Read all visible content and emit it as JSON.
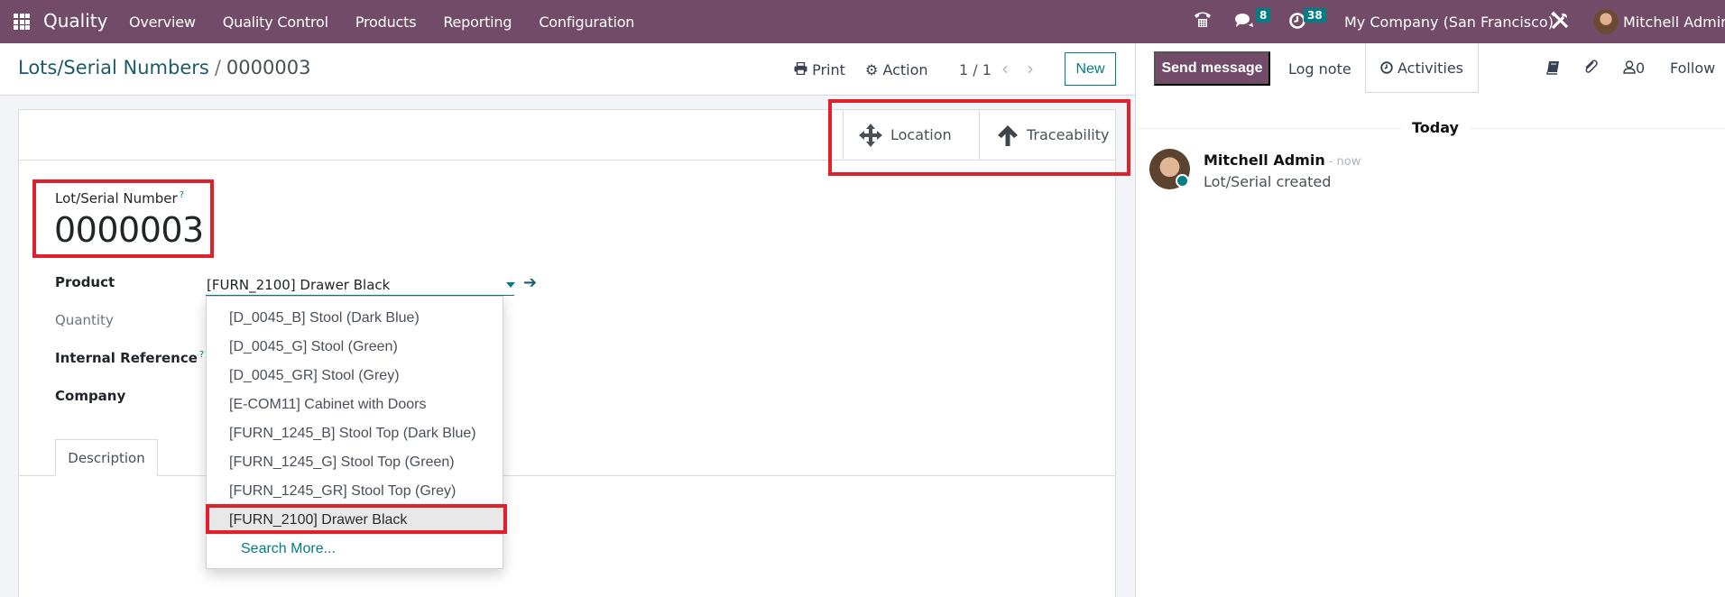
{
  "navbar": {
    "app_name": "Quality",
    "menu": [
      "Overview",
      "Quality Control",
      "Products",
      "Reporting",
      "Configuration"
    ],
    "messages_count": "8",
    "activities_count": "38",
    "company": "My Company (San Francisco)",
    "user": "Mitchell Admin",
    "icons": [
      "apps-grid-icon",
      "phone-icon",
      "chat-icon",
      "clock-icon",
      "tools-icon"
    ]
  },
  "control_panel": {
    "breadcrumb_parent": "Lots/Serial Numbers",
    "breadcrumb_separator": "/",
    "breadcrumb_current": "0000003",
    "print_label": "Print",
    "action_label": "Action",
    "pager": "1 / 1",
    "new_label": "New"
  },
  "smart_buttons": [
    {
      "label": "Location",
      "icon": "arrows-move-icon"
    },
    {
      "label": "Traceability",
      "icon": "arrow-up-icon"
    }
  ],
  "form": {
    "lot_label": "Lot/Serial Number",
    "lot_help": "?",
    "lot_value": "0000003",
    "fields": {
      "product_label": "Product",
      "product_value": "[FURN_2100] Drawer Black",
      "quantity_label": "Quantity",
      "internal_ref_label": "Internal Reference",
      "internal_ref_help": "?",
      "company_label": "Company"
    },
    "tabs": [
      "Description"
    ]
  },
  "product_dropdown": {
    "options": [
      "[D_0045_B] Stool (Dark Blue)",
      "[D_0045_G] Stool (Green)",
      "[D_0045_GR] Stool (Grey)",
      "[E-COM11] Cabinet with Doors",
      "[FURN_1245_B] Stool Top (Dark Blue)",
      "[FURN_1245_G] Stool Top (Green)",
      "[FURN_1245_GR] Stool Top (Grey)",
      "[FURN_2100] Drawer Black"
    ],
    "selected": "[FURN_2100] Drawer Black",
    "search_more": "Search More..."
  },
  "chatter": {
    "send_message": "Send message",
    "log_note": "Log note",
    "activities": "Activities",
    "followers_count": "0",
    "follow_label": "Follow",
    "date_separator": "Today",
    "messages": [
      {
        "author": "Mitchell Admin",
        "time": "- now",
        "body": "Lot/Serial created"
      }
    ]
  },
  "colors": {
    "brand": "#714b67",
    "accent": "#017e84",
    "highlight": "#e0202b"
  }
}
